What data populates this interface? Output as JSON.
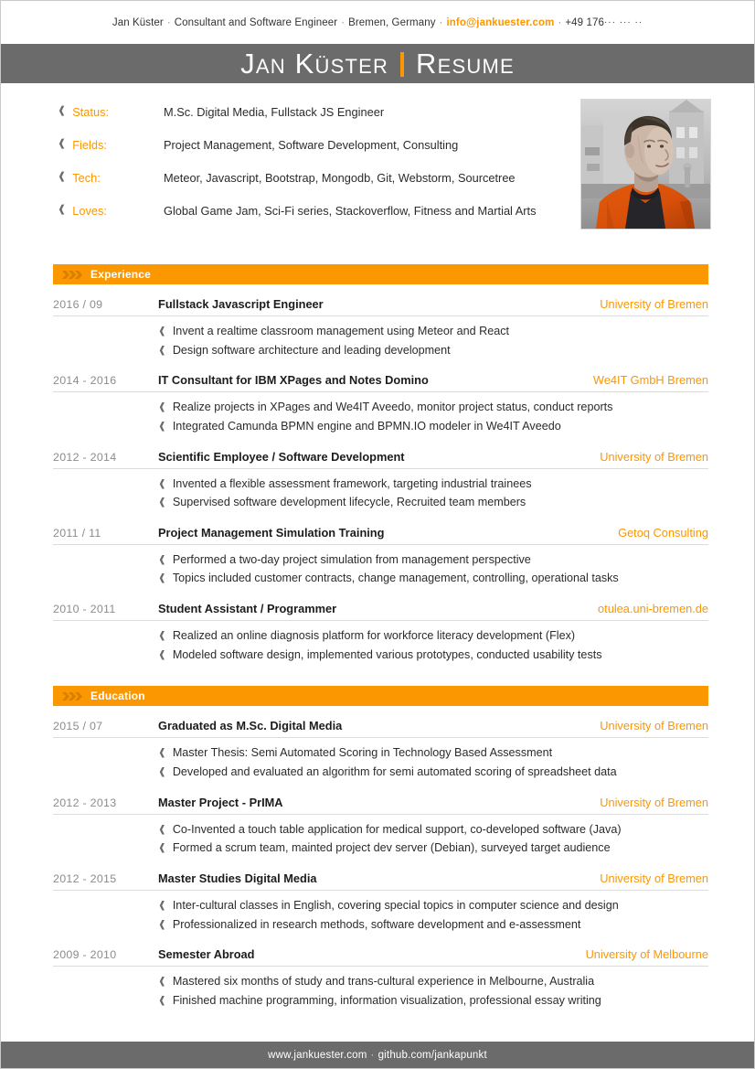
{
  "colors": {
    "accent_orange": "#fb9700",
    "bar_gray": "#6b6b6b",
    "text_dark": "#2b2b2b",
    "date_gray": "#8c8c8c",
    "rule_gray": "#dcdcdc"
  },
  "contact": {
    "name": "Jan Küster",
    "role": "Consultant and Software Engineer",
    "location": "Bremen, Germany",
    "email": "info@jankuester.com",
    "phone_prefix": "+49 176",
    "phone_mask": "··· ··· ··",
    "separator": "·"
  },
  "title_bar": {
    "name": "Jan Küster",
    "document_type": "Resume"
  },
  "info": {
    "rows": [
      {
        "label": "Status:",
        "value": "M.Sc. Digital Media, Fullstack JS Engineer"
      },
      {
        "label": "Fields:",
        "value": "Project Management, Software Development, Consulting"
      },
      {
        "label": "Tech:",
        "value": "Meteor, Javascript, Bootstrap, Mongodb, Git, Webstorm, Sourcetree"
      },
      {
        "label": "Loves:",
        "value": "Global Game Jam, Sci-Fi series, Stackoverflow, Fitness and Martial Arts"
      }
    ],
    "photo_alt": "Portrait photo of Jan Küster"
  },
  "sections": [
    {
      "title": "Experience",
      "entries": [
        {
          "date": "2016 / 09",
          "title": "Fullstack Javascript Engineer",
          "org": "University of Bremen",
          "points": [
            "Invent a realtime classroom management using Meteor and React",
            "Design software architecture and leading development"
          ]
        },
        {
          "date": "2014 - 2016",
          "title": "IT Consultant for IBM XPages and Notes Domino",
          "org": "We4IT GmbH Bremen",
          "points": [
            "Realize projects in XPages and We4IT Aveedo, monitor project status, conduct reports",
            "Integrated Camunda BPMN engine and BPMN.IO modeler in We4IT Aveedo"
          ]
        },
        {
          "date": "2012 - 2014",
          "title": "Scientific Employee / Software Development",
          "org": "University of Bremen",
          "points": [
            "Invented a flexible assessment framework, targeting industrial trainees",
            "Supervised software development lifecycle, Recruited team members"
          ]
        },
        {
          "date": "2011 / 11",
          "title": "Project Management Simulation Training",
          "org": "Getoq Consulting",
          "points": [
            "Performed a two-day project simulation from management perspective",
            "Topics included customer contracts, change management, controlling, operational tasks"
          ]
        },
        {
          "date": "2010 - 2011",
          "title": "Student Assistant / Programmer",
          "org": "otulea.uni-bremen.de",
          "points": [
            "Realized an online diagnosis platform for workforce literacy development (Flex)",
            "Modeled software design, implemented various prototypes, conducted usability tests"
          ]
        }
      ]
    },
    {
      "title": "Education",
      "entries": [
        {
          "date": "2015 / 07",
          "title": "Graduated as M.Sc. Digital Media",
          "org": "University of Bremen",
          "points": [
            "Master Thesis: Semi Automated Scoring in Technology Based Assessment",
            "Developed and evaluated an algorithm for semi automated scoring of spreadsheet data"
          ]
        },
        {
          "date": "2012 - 2013",
          "title": "Master Project - PrIMA",
          "org": "University of Bremen",
          "points": [
            "Co-Invented a touch table application for medical support, co-developed software (Java)",
            "Formed a scrum team, mainted project dev server (Debian), surveyed target audience"
          ]
        },
        {
          "date": "2012 - 2015",
          "title": "Master Studies Digital Media",
          "org": "University of Bremen",
          "points": [
            "Inter-cultural classes in English, covering special topics in computer science and design",
            "Professionalized in research methods, software development and e-assessment"
          ]
        },
        {
          "date": "2009 - 2010",
          "title": "Semester Abroad",
          "org": "University of Melbourne",
          "points": [
            "Mastered six months of study and trans-cultural experience in Melbourne, Australia",
            "Finished machine programming, information visualization, professional essay writing"
          ]
        }
      ]
    }
  ],
  "footer": {
    "website": "www.jankuester.com",
    "separator": "·",
    "github": "github.com/jankapunkt"
  },
  "icons": {
    "bullet": "chevron-right-icon",
    "section": "triple-chevron-icon"
  }
}
